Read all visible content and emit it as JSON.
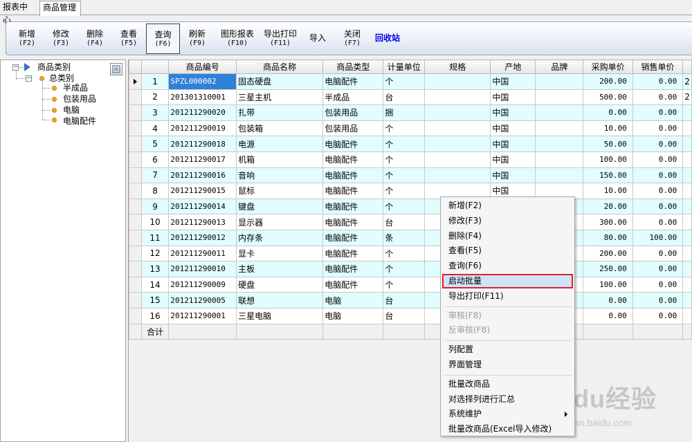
{
  "tabs": [
    {
      "label": "报表中心",
      "active": false
    },
    {
      "label": "商品管理",
      "active": true
    }
  ],
  "toolbar": {
    "buttons": [
      {
        "label": "新增",
        "key": "(F2)"
      },
      {
        "label": "修改",
        "key": "(F3)"
      },
      {
        "label": "删除",
        "key": "(F4)"
      },
      {
        "label": "查看",
        "key": "(F5)"
      },
      {
        "label": "查询",
        "key": "(F6)",
        "pressed": true
      },
      {
        "label": "刷新",
        "key": "(F9)"
      },
      {
        "label": "图形报表",
        "key": "(F10)"
      },
      {
        "label": "导出打印",
        "key": "(F11)"
      },
      {
        "label": "导入",
        "key": ""
      },
      {
        "label": "关闭",
        "key": "(F7)"
      },
      {
        "label": "回收站",
        "key": "",
        "accent": "#0000ee"
      }
    ]
  },
  "tree": {
    "root": "商品类别",
    "group": "总类别",
    "children": [
      "半成品",
      "包装用品",
      "电脑",
      "电脑配件"
    ],
    "icons": {
      "root": "arrow-icon",
      "node": "folder-dot-icon",
      "refresh": "refresh-icon"
    }
  },
  "grid": {
    "columns": [
      "",
      "",
      "商品编号",
      "商品名称",
      "商品类型",
      "计量单位",
      "规格",
      "产地",
      "品牌",
      "采购单价",
      "销售单价",
      ""
    ],
    "rows": [
      {
        "no": "1",
        "code": "SPZL000002",
        "name": "固态硬盘",
        "type": "电脑配件",
        "unit": "个",
        "spec": "",
        "origin": "中国",
        "brand": "",
        "buy": "200.00",
        "sell": "0.00",
        "extra": "2"
      },
      {
        "no": "2",
        "code": "201301310001",
        "name": "三星主机",
        "type": "半成品",
        "unit": "台",
        "spec": "",
        "origin": "中国",
        "brand": "",
        "buy": "500.00",
        "sell": "0.00",
        "extra": "2"
      },
      {
        "no": "3",
        "code": "201211290020",
        "name": "扎带",
        "type": "包装用品",
        "unit": "捆",
        "spec": "",
        "origin": "中国",
        "brand": "",
        "buy": "0.00",
        "sell": "0.00",
        "extra": ""
      },
      {
        "no": "4",
        "code": "201211290019",
        "name": "包装箱",
        "type": "包装用品",
        "unit": "个",
        "spec": "",
        "origin": "中国",
        "brand": "",
        "buy": "10.00",
        "sell": "0.00",
        "extra": ""
      },
      {
        "no": "5",
        "code": "201211290018",
        "name": "电源",
        "type": "电脑配件",
        "unit": "个",
        "spec": "",
        "origin": "中国",
        "brand": "",
        "buy": "50.00",
        "sell": "0.00",
        "extra": ""
      },
      {
        "no": "6",
        "code": "201211290017",
        "name": "机箱",
        "type": "电脑配件",
        "unit": "个",
        "spec": "",
        "origin": "中国",
        "brand": "",
        "buy": "100.00",
        "sell": "0.00",
        "extra": ""
      },
      {
        "no": "7",
        "code": "201211290016",
        "name": "音响",
        "type": "电脑配件",
        "unit": "个",
        "spec": "",
        "origin": "中国",
        "brand": "",
        "buy": "150.00",
        "sell": "0.00",
        "extra": ""
      },
      {
        "no": "8",
        "code": "201211290015",
        "name": "鼠标",
        "type": "电脑配件",
        "unit": "个",
        "spec": "",
        "origin": "中国",
        "brand": "",
        "buy": "10.00",
        "sell": "0.00",
        "extra": ""
      },
      {
        "no": "9",
        "code": "201211290014",
        "name": "键盘",
        "type": "电脑配件",
        "unit": "个",
        "spec": "",
        "origin": "",
        "brand": "",
        "buy": "20.00",
        "sell": "0.00",
        "extra": ""
      },
      {
        "no": "10",
        "code": "201211290013",
        "name": "显示器",
        "type": "电脑配件",
        "unit": "台",
        "spec": "",
        "origin": "",
        "brand": "",
        "buy": "300.00",
        "sell": "0.00",
        "extra": ""
      },
      {
        "no": "11",
        "code": "201211290012",
        "name": "内存条",
        "type": "电脑配件",
        "unit": "条",
        "spec": "",
        "origin": "",
        "brand": "",
        "buy": "80.00",
        "sell": "100.00",
        "extra": ""
      },
      {
        "no": "12",
        "code": "201211290011",
        "name": "显卡",
        "type": "电脑配件",
        "unit": "个",
        "spec": "",
        "origin": "",
        "brand": "",
        "buy": "200.00",
        "sell": "0.00",
        "extra": ""
      },
      {
        "no": "13",
        "code": "201211290010",
        "name": "主板",
        "type": "电脑配件",
        "unit": "个",
        "spec": "",
        "origin": "",
        "brand": "",
        "buy": "250.00",
        "sell": "0.00",
        "extra": ""
      },
      {
        "no": "14",
        "code": "201211290009",
        "name": "硬盘",
        "type": "电脑配件",
        "unit": "个",
        "spec": "",
        "origin": "",
        "brand": "",
        "buy": "100.00",
        "sell": "0.00",
        "extra": ""
      },
      {
        "no": "15",
        "code": "201211290005",
        "name": "联想",
        "type": "电脑",
        "unit": "台",
        "spec": "",
        "origin": "",
        "brand": "",
        "buy": "0.00",
        "sell": "0.00",
        "extra": ""
      },
      {
        "no": "16",
        "code": "201211290001",
        "name": "三星电脑",
        "type": "电脑",
        "unit": "台",
        "spec": "",
        "origin": "",
        "brand": "",
        "buy": "0.00",
        "sell": "0.00",
        "extra": ""
      }
    ],
    "total_label": "合计",
    "colors": {
      "alt_row": "#e1fdfd",
      "selected_cell": "#2f80d8"
    }
  },
  "context_menu": {
    "items": [
      {
        "label": "新增(F2)"
      },
      {
        "label": "修改(F3)"
      },
      {
        "label": "删除(F4)"
      },
      {
        "label": "查看(F5)"
      },
      {
        "label": "查询(F6)"
      },
      {
        "label": "启动批量",
        "highlighted": true
      },
      {
        "label": "导出打印(F11)"
      },
      {
        "separator": true
      },
      {
        "label": "审核(F8)",
        "disabled": true
      },
      {
        "label": "反审核(F8)",
        "disabled": true
      },
      {
        "separator": true
      },
      {
        "label": "列配置"
      },
      {
        "label": "界面管理"
      },
      {
        "separator": true
      },
      {
        "label": "批量改商品"
      },
      {
        "label": "对选择列进行汇总"
      },
      {
        "label": "系统维护",
        "submenu": true
      },
      {
        "label": "批量改商品(Excel导入修改)"
      }
    ],
    "highlight_border_color": "#e0202a"
  },
  "watermark": {
    "big": "Baidu经验",
    "small": "jingyan.baidu.com"
  }
}
